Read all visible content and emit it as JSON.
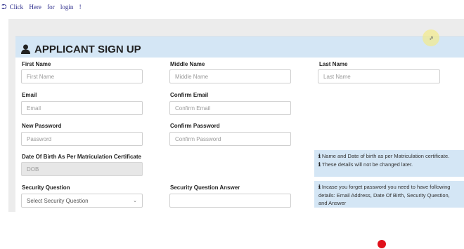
{
  "top_link": {
    "icon": "sign-in-icon",
    "text": "Click Here for login !"
  },
  "form": {
    "title": "APPLICANT SIGN UP",
    "title_icon": "user-icon",
    "first_name": {
      "label": "First Name",
      "placeholder": "First Name"
    },
    "middle_name": {
      "label": "Middle Name",
      "placeholder": "Middle Name"
    },
    "last_name": {
      "label": "Last Name",
      "placeholder": "Last Name"
    },
    "email": {
      "label": "Email",
      "placeholder": "Email"
    },
    "confirm_email": {
      "label": "Confirm Email",
      "placeholder": "Confirm Email"
    },
    "new_password": {
      "label": "New Password",
      "placeholder": "Password"
    },
    "confirm_password": {
      "label": "Confirm Password",
      "placeholder": "Confirm Password"
    },
    "dob": {
      "label": "Date Of Birth As Per Matriculation Certificate",
      "placeholder": "DOB"
    },
    "security_question": {
      "label": "Security Question",
      "selected": "Select Security Question"
    },
    "security_answer": {
      "label": "Security Question Answer",
      "value": ""
    }
  },
  "info": {
    "dob_note_1": "Name and Date of birth as per Matriculation certificate.",
    "dob_note_2": "These details will not be changed later.",
    "password_note": "Incase you forget password you need to have following details: Email Address, Date Of Birth, Security Question, and Answer"
  },
  "colors": {
    "header_band": "#d4e6f5",
    "accent_dot": "#e0101a"
  }
}
